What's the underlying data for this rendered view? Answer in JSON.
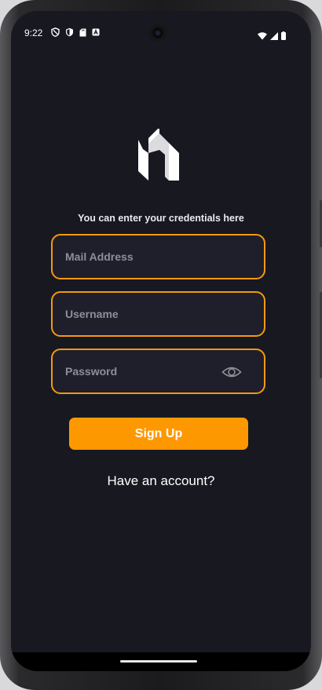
{
  "status_bar": {
    "time": "9:22",
    "left_icons": [
      "shield-outline-icon",
      "shield-filled-icon",
      "sd-card-icon",
      "text-recognition-icon"
    ],
    "right_icons": [
      "wifi-icon",
      "signal-icon",
      "battery-icon"
    ]
  },
  "header": {
    "logo_icon": "brand-logo-icon",
    "subtitle": "You can enter your credentials here"
  },
  "form": {
    "mail": {
      "placeholder": "Mail Address",
      "value": ""
    },
    "username": {
      "placeholder": "Username",
      "value": ""
    },
    "password": {
      "placeholder": "Password",
      "value": "",
      "toggle_icon": "eye-icon"
    },
    "signup_label": "Sign Up"
  },
  "footer": {
    "have_account": "Have an account?"
  },
  "colors": {
    "background": "#181820",
    "accent": "#fe9800",
    "field_border": "#f49a0e",
    "field_fill": "#1f1e2b",
    "placeholder": "#8f8e97",
    "text": "#ffffff"
  }
}
